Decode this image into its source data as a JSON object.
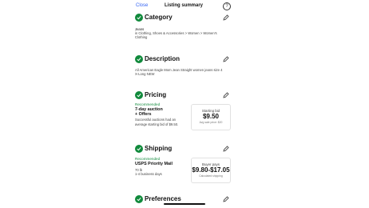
{
  "header": {
    "close_label": "Close",
    "title": "Listing summary",
    "help_label": "?"
  },
  "colors": {
    "accent": "#118a3c",
    "link": "#3665f3"
  },
  "icons": {
    "check": "check-circle-icon",
    "edit": "pencil-icon",
    "help": "question-circle-icon"
  },
  "category": {
    "title": "Category",
    "value": "Jeans",
    "path": "in Clothing, Shoes & Accessories > Women > Women's Clothing"
  },
  "description": {
    "title": "Description",
    "value": "All American Eagle Mom Jean Straight women jeans size 4 X-Long NEW"
  },
  "pricing": {
    "title": "Pricing",
    "recommended": "Recommended",
    "format_line1": "7-day auction",
    "format_line2": "+ Offers",
    "note": "Successful auctions had an average starting bid of $9.50.",
    "box_label": "Starting bid",
    "box_value": "$9.50",
    "box_sub": "Avg sale price: $20"
  },
  "shipping": {
    "title": "Shipping",
    "recommended": "Recommended",
    "service": "USPS Priority Mail",
    "weight": "70 lb",
    "days": "1-4 business days",
    "box_label": "Buyer pays",
    "box_value": "$9.80-$17.05",
    "box_sub": "Calculated shipping"
  },
  "preferences": {
    "title": "Preferences"
  }
}
